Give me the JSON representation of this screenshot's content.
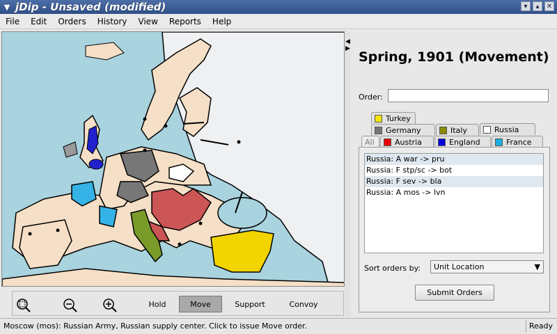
{
  "window": {
    "title": "jDip - Unsaved (modified)"
  },
  "menu": [
    "File",
    "Edit",
    "Orders",
    "History",
    "View",
    "Reports",
    "Help"
  ],
  "toolbar": {
    "hold": "Hold",
    "move": "Move",
    "support": "Support",
    "convoy": "Convoy",
    "selected": "Move"
  },
  "panel": {
    "phase": "Spring, 1901 (Movement)",
    "order_label": "Order:",
    "order_value": "",
    "tabs": [
      {
        "label": "Turkey",
        "color": "#f2e400"
      },
      {
        "label": "Germany",
        "color": "#777777"
      },
      {
        "label": "Italy",
        "color": "#8a8a00"
      },
      {
        "label": "Russia",
        "color": "#ffffff"
      },
      {
        "label": "All",
        "color": ""
      },
      {
        "label": "Austria",
        "color": "#ee0000"
      },
      {
        "label": "England",
        "color": "#0000dd"
      },
      {
        "label": "France",
        "color": "#1aafe0"
      }
    ],
    "orders": [
      "Russia: A war -> pru",
      "Russia: F stp/sc -> bot",
      "Russia: F sev -> bla",
      "Russia: A mos -> lvn"
    ],
    "sort_label": "Sort orders by:",
    "sort_value": "Unit Location",
    "submit": "Submit Orders"
  },
  "status": {
    "message": "Moscow (mos): Russian Army, Russian supply center. Click to issue Move order.",
    "state": "Ready"
  }
}
